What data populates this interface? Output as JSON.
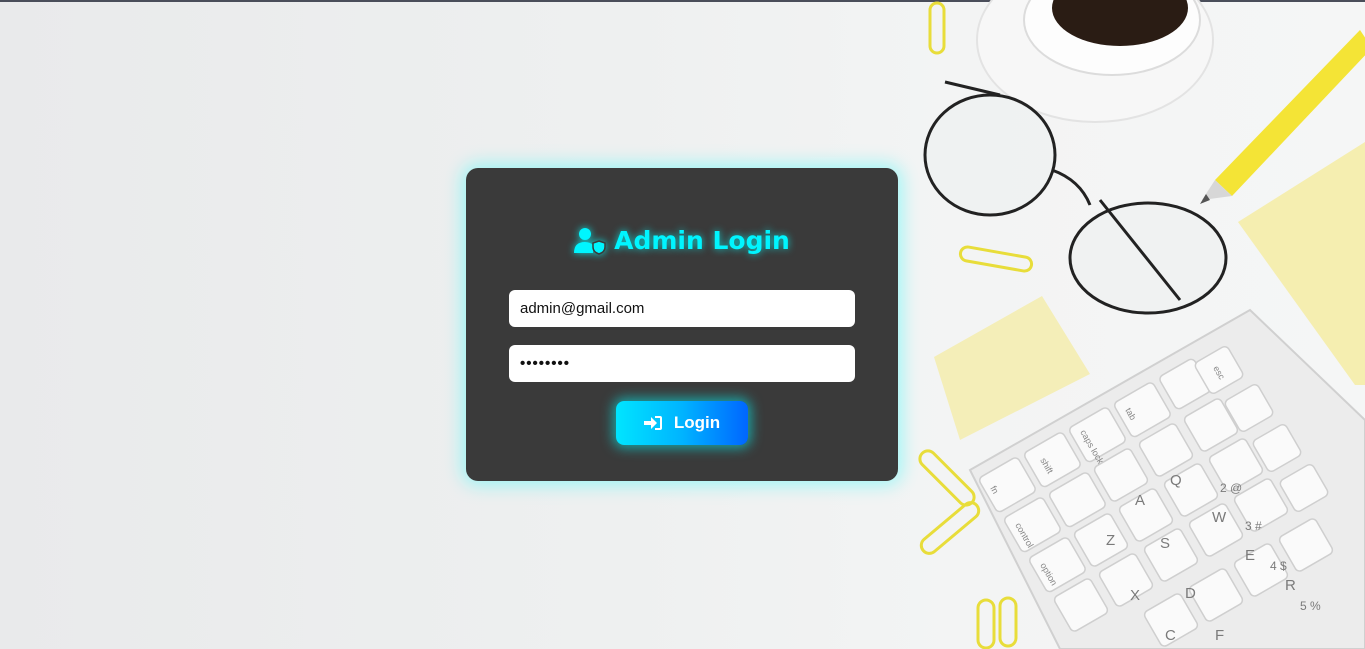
{
  "login": {
    "title": "Admin Login",
    "email_value": "admin@gmail.com",
    "password_value": "••••••••",
    "button_label": "Login",
    "accent_color": "#00f5ff"
  },
  "icons": {
    "title_icon": "user-shield-icon",
    "button_icon": "sign-in-icon"
  },
  "keyboard": {
    "key_labels": [
      "esc",
      "tab",
      "caps lock",
      "shift",
      "fn",
      "control",
      "option",
      "Q",
      "W",
      "A",
      "S",
      "Z",
      "X",
      "D",
      "E",
      "R",
      "F",
      "C",
      "2 @",
      "3 #",
      "4 $",
      "5 %"
    ]
  }
}
